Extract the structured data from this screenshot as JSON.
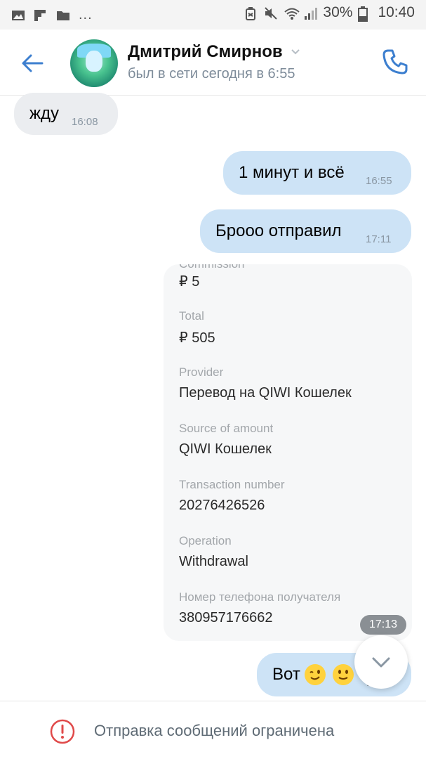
{
  "status_bar": {
    "left_icons": [
      "image-icon",
      "flipboard-icon",
      "folder-icon"
    ],
    "dots": "...",
    "battery": "30%",
    "time": "10:40"
  },
  "header": {
    "name": "Дмитрий Смирнов",
    "status": "был в сети сегодня в 6:55"
  },
  "messages": [
    {
      "direction": "incoming",
      "text": "жду",
      "time": "16:08"
    },
    {
      "direction": "outgoing",
      "text": "1 минут и всё",
      "time": "16:55"
    },
    {
      "direction": "outgoing",
      "text": "Броoo отправил",
      "time": "17:11"
    }
  ],
  "receipt": {
    "cut_label": "Commission",
    "commission": "₽ 5",
    "fields": [
      {
        "label": "Total",
        "value": "₽ 505"
      },
      {
        "label": "Provider",
        "value": "Перевод на QIWI Кошелек"
      },
      {
        "label": "Source of amount",
        "value": "QIWI Кошелек"
      },
      {
        "label": "Transaction number",
        "value": "20276426526"
      },
      {
        "label": "Operation",
        "value": "Withdrawal"
      },
      {
        "label": "Номер телефона получателя",
        "value": "380957176662"
      }
    ],
    "time": "17:13"
  },
  "last_message": {
    "text": "Вот",
    "emojis": [
      "winking-face",
      "slightly-smiling-face"
    ],
    "time": "17:13"
  },
  "footer": {
    "text": "Отправка сообщений ограничена"
  },
  "colors": {
    "accent": "#3d7fcf",
    "outgoing_bubble": "#cde3f6",
    "incoming_bubble": "#ebedf0",
    "warning": "#e04a4a"
  }
}
